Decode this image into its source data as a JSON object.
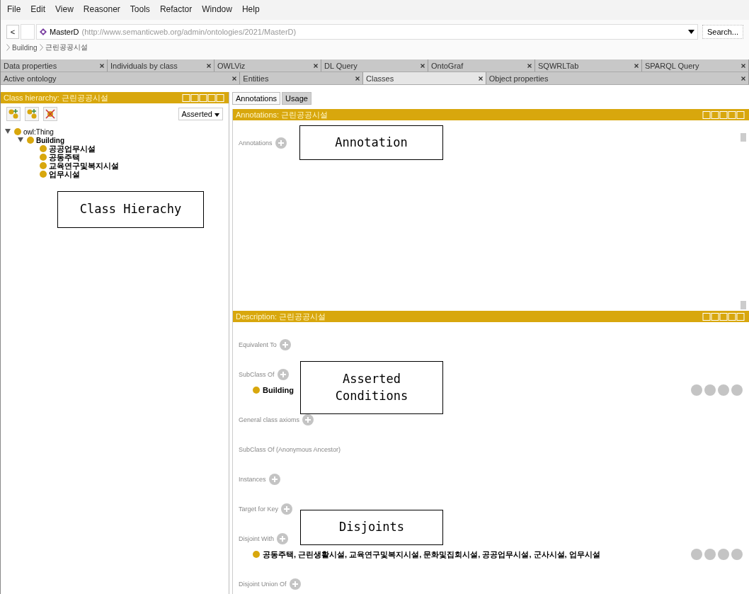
{
  "menu": [
    "File",
    "Edit",
    "View",
    "Reasoner",
    "Tools",
    "Refactor",
    "Window",
    "Help"
  ],
  "address": {
    "back": "<",
    "name": "MasterD",
    "iri": "(http://www.semanticweb.org/admin/ontologies/2021/MasterD)",
    "search": "Search..."
  },
  "breadcrumb": [
    "Building",
    "근린공공시설"
  ],
  "tab_rows": [
    [
      {
        "label": "Data properties",
        "selected": false
      },
      {
        "label": "Individuals by class",
        "selected": false
      },
      {
        "label": "OWLViz",
        "selected": false
      },
      {
        "label": "DL Query",
        "selected": false
      },
      {
        "label": "OntoGraf",
        "selected": false
      },
      {
        "label": "SQWRLTab",
        "selected": false
      },
      {
        "label": "SPARQL Query",
        "selected": false
      }
    ],
    [
      {
        "label": "Active ontology",
        "selected": false
      },
      {
        "label": "Entities",
        "selected": false
      },
      {
        "label": "Classes",
        "selected": true
      },
      {
        "label": "Object properties",
        "selected": false
      }
    ]
  ],
  "class_panel": {
    "title": "Class hierarchy: 근린공공시설",
    "mode": "Asserted",
    "tree": [
      {
        "label": "owl:Thing",
        "expanded": true,
        "children": [
          {
            "label": "Building",
            "expanded": true,
            "children": [
              {
                "label": "공공업무시설"
              },
              {
                "label": "공동주택"
              },
              {
                "label": "교육연구및복지시설"
              },
              {
                "label": "업무시설"
              }
            ]
          }
        ]
      }
    ]
  },
  "view_tabs": [
    {
      "label": "Annotations",
      "selected": true
    },
    {
      "label": "Usage",
      "selected": false
    }
  ],
  "annotations_panel": {
    "title": "Annotations: 근린공공시설",
    "sections": [
      {
        "label": "Annotations"
      }
    ]
  },
  "description_panel": {
    "title": "Description: 근린공공시설",
    "sections": [
      {
        "label": "Equivalent To"
      },
      {
        "label": "SubClass Of",
        "items": [
          "Building"
        ]
      },
      {
        "label": "General class axioms"
      },
      {
        "label": "SubClass Of (Anonymous Ancestor)",
        "addable": false
      },
      {
        "label": "Instances"
      },
      {
        "label": "Target for Key"
      },
      {
        "label": "Disjoint With",
        "items": [
          "공동주택, 근린생활시설, 교육연구및복지시설, 문화및집회시설, 공공업무시설, 군사시설, 업무시설"
        ]
      },
      {
        "label": "Disjoint Union Of"
      }
    ]
  },
  "callouts": [
    "Annotation",
    "Class Hierachy",
    "Asserted\nConditions",
    "Disjoints"
  ]
}
